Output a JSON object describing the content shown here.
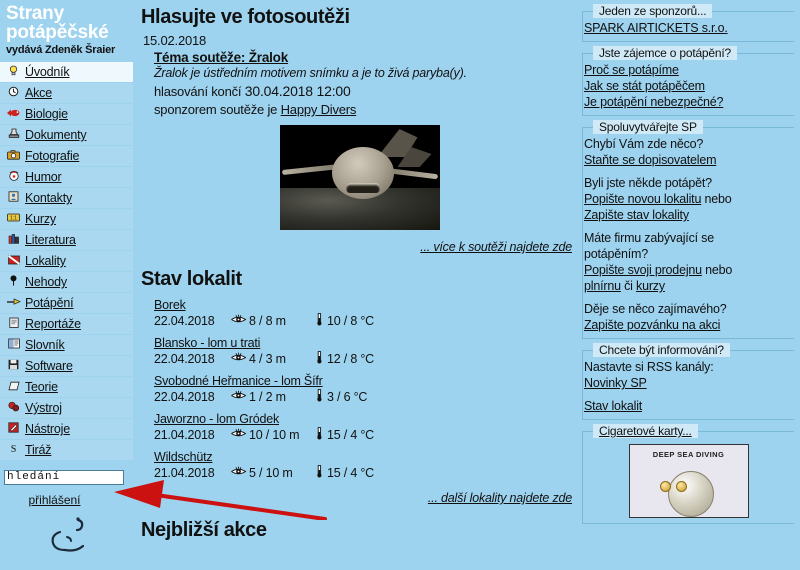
{
  "site": {
    "brand_line1": "Strany",
    "brand_line2": "potápěčské",
    "publisher": "vydává Zdeněk Šraier"
  },
  "sidebar": {
    "items": [
      {
        "label": "Úvodník",
        "icon": "lightbulb-icon",
        "glyph": "💡"
      },
      {
        "label": "Akce",
        "icon": "clock-icon",
        "glyph": "◴"
      },
      {
        "label": "Biologie",
        "icon": "fish-icon",
        "glyph": "❧"
      },
      {
        "label": "Dokumenty",
        "icon": "stamp-icon",
        "glyph": "♟"
      },
      {
        "label": "Fotografie",
        "icon": "camera-icon",
        "glyph": "▣"
      },
      {
        "label": "Humor",
        "icon": "clown-icon",
        "glyph": "☺"
      },
      {
        "label": "Kontakty",
        "icon": "contact-icon",
        "glyph": "✉"
      },
      {
        "label": "Kurzy",
        "icon": "ticket-icon",
        "glyph": "▭"
      },
      {
        "label": "Literatura",
        "icon": "books-icon",
        "glyph": "‖"
      },
      {
        "label": "Lokality",
        "icon": "diveflag-icon",
        "glyph": "◥"
      },
      {
        "label": "Nehody",
        "icon": "pin-icon",
        "glyph": "⚲"
      },
      {
        "label": "Potápění",
        "icon": "diver-icon",
        "glyph": "➤"
      },
      {
        "label": "Reportáže",
        "icon": "clipboard-icon",
        "glyph": "☰"
      },
      {
        "label": "Slovník",
        "icon": "dictionary-icon",
        "glyph": "▤"
      },
      {
        "label": "Software",
        "icon": "floppy-icon",
        "glyph": "■"
      },
      {
        "label": "Teorie",
        "icon": "diamond-icon",
        "glyph": "◇"
      },
      {
        "label": "Výstroj",
        "icon": "gear-icon",
        "glyph": "❀"
      },
      {
        "label": "Nástroje",
        "icon": "tools-icon",
        "glyph": "✎"
      },
      {
        "label": "Tiráž",
        "icon": "dollar-icon",
        "glyph": "§"
      }
    ],
    "search_value": "hledání",
    "search_placeholder": "hledání",
    "login_label": "přihlášení"
  },
  "main": {
    "contest": {
      "heading": "Hlasujte ve fotosoutěži",
      "date": "15.02.2018",
      "theme": "Téma soutěže: Žralok",
      "description": "Žralok je ústředním motivem snímku a je to živá paryba(y).",
      "voting_prefix": "hlasování končí",
      "voting_deadline": "30.04.2018 12:00",
      "sponsor_prefix": "sponzorem soutěže je",
      "sponsor_name": "Happy Divers",
      "photo_alt": "žralok",
      "more_link": "... více k soutěži najdete zde"
    },
    "localities": {
      "heading": "Stav lokalit",
      "rows": [
        {
          "name": "Borek",
          "date": "22.04.2018",
          "visibility": "8 / 8 m",
          "temperature": "10 / 8 °C"
        },
        {
          "name": "Blansko - lom u trati",
          "date": "22.04.2018",
          "visibility": "4 / 3 m",
          "temperature": "12 / 8 °C"
        },
        {
          "name": "Svobodné Heřmanice - lom Šífr",
          "date": "22.04.2018",
          "visibility": "1 / 2 m",
          "temperature": "3 / 6 °C"
        },
        {
          "name": "Jaworzno - lom Gródek",
          "date": "21.04.2018",
          "visibility": "10 / 10 m",
          "temperature": "15 / 4 °C"
        },
        {
          "name": "Wildschütz",
          "date": "21.04.2018",
          "visibility": "5 / 10 m",
          "temperature": "15 / 4 °C"
        }
      ],
      "more_link": "... další lokality najdete zde"
    },
    "events_heading": "Nejbližší akce"
  },
  "right": {
    "sponsor_box": {
      "legend": "Jeden ze sponzorů...",
      "link": "SPARK AIRTICKETS s.r.o."
    },
    "interest_box": {
      "legend": "Jste zájemce o potápění?",
      "links": [
        "Proč se potápíme",
        "Jak se stát potápěčem",
        "Je potápění nebezpečné?"
      ]
    },
    "cocreate_box": {
      "legend": "Spoluvytvářejte SP",
      "q1": "Chybí Vám zde něco?",
      "a1": "Staňte se dopisovatelem",
      "q2": "Byli jste někde potápět?",
      "a2a": "Popište novou lokalitu",
      "a2_mid": " nebo",
      "a2b": "Zapište stav lokality",
      "q3a": "Máte firmu zabývající se",
      "q3b": "potápěním?",
      "a3a": "Popište svoji prodejnu",
      "a3_mid": " nebo",
      "a3b": "plnírnu",
      "a3_mid2": " či ",
      "a3c": "kurzy",
      "q4": "Děje se něco zajímavého?",
      "a4": "Zapište pozvánku na akci"
    },
    "rss_box": {
      "legend": "Chcete být informováni?",
      "intro": "Nastavte si RSS kanály:",
      "link1": "Novinky SP",
      "link2": "Stav lokalit"
    },
    "cards_box": {
      "legend": "Cigaretové karty...",
      "card_caption": "DEEP SEA DIVING"
    }
  },
  "annotation": {
    "arrow_color": "#cc1111",
    "points_to": "přihlášení"
  },
  "icons": {
    "eye": "visibility-icon",
    "thermometer": "thermometer-icon"
  },
  "colors": {
    "page_bg": "#9ed3ef",
    "menu_bg": "#a9d8f0",
    "menu_active_bg": "#eef8fd",
    "legend_bg": "#cfe9f6",
    "box_border": "#7ab8d8"
  }
}
